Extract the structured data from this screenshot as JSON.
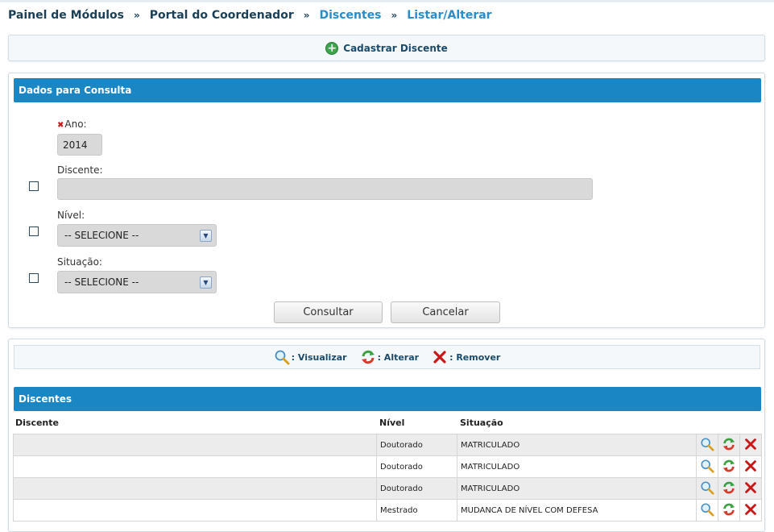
{
  "breadcrumb": {
    "item1": "Painel de Módulos",
    "item2": "Portal do Coordenador",
    "item3": "Discentes",
    "item4": "Listar/Alterar",
    "separator": "»"
  },
  "actions": {
    "cadastrar": "Cadastrar Discente"
  },
  "query": {
    "header": "Dados para Consulta",
    "ano_label": "Ano:",
    "ano_value": "2014",
    "discente_label": "Discente:",
    "discente_value": "",
    "nivel_label": "Nível:",
    "nivel_value": "-- SELECIONE --",
    "situacao_label": "Situação:",
    "situacao_value": "-- SELECIONE --",
    "consultar": "Consultar",
    "cancelar": "Cancelar"
  },
  "legend": {
    "visualizar": ": Visualizar",
    "alterar": ": Alterar",
    "remover": ": Remover"
  },
  "results": {
    "header": "Discentes",
    "columns": [
      "Discente",
      "Nível",
      "Situação"
    ],
    "rows": [
      {
        "discente": "",
        "nivel": "Doutorado",
        "situacao": "MATRICULADO"
      },
      {
        "discente": "",
        "nivel": "Doutorado",
        "situacao": "MATRICULADO"
      },
      {
        "discente": "",
        "nivel": "Doutorado",
        "situacao": "MATRICULADO"
      },
      {
        "discente": "",
        "nivel": "Mestrado",
        "situacao": "MUDANCA DE NÍVEL COM DEFESA"
      }
    ]
  },
  "colors": {
    "header_blue": "#1a86c4",
    "breadcrumb_dark": "#1b3f57",
    "breadcrumb_light": "#2a8cc8",
    "remove_red": "#c81818"
  },
  "icons": [
    "plus-icon",
    "magnifier-icon",
    "refresh-icon",
    "remove-icon",
    "chevron-down-icon"
  ]
}
